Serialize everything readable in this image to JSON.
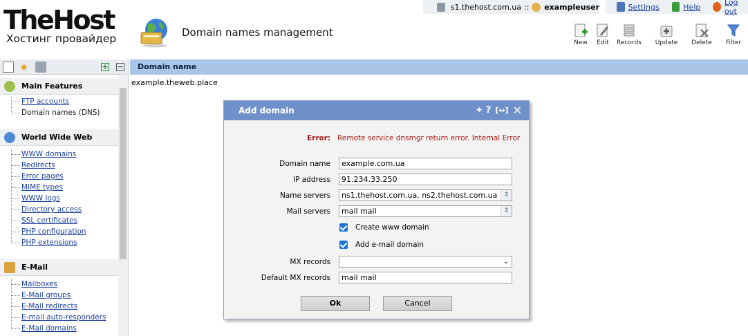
{
  "topbar": {
    "host": "s1.thehost.com.ua",
    "separator": "::",
    "username": "exampleuser",
    "settings": "Settings",
    "help": "Help",
    "logout": "Log out"
  },
  "logo": {
    "main": "TheHost",
    "sub": "Хостинг провайдер"
  },
  "page_title": "Domain names management",
  "toolbar": {
    "new": "New",
    "edit": "Edit",
    "records": "Records",
    "update": "Update",
    "delete": "Delete",
    "filter": "Filter"
  },
  "sidebar": {
    "sections": [
      {
        "title": "Main Features",
        "items": [
          "FTP accounts",
          "Domain names (DNS)"
        ]
      },
      {
        "title": "World Wide Web",
        "items": [
          "WWW domains",
          "Redirects",
          "Error pages",
          "MIME types",
          "WWW logs",
          "Directory access",
          "SSL certificates",
          "PHP configuration",
          "PHP extensions"
        ]
      },
      {
        "title": "E-Mail",
        "items": [
          "Mailboxes",
          "E-Mail groups",
          "E-Mail redirects",
          "E-mail auto-responders",
          "E-Mail domains"
        ]
      }
    ]
  },
  "list": {
    "column": "Domain name",
    "rows": [
      "example.theweb.place"
    ]
  },
  "dialog": {
    "title": "Add domain",
    "error_label": "Error:",
    "error_text": "Remote service dnsmgr return error. Internal Error",
    "fields": {
      "domain_name": {
        "label": "Domain name",
        "value": "example.com.ua"
      },
      "ip_address": {
        "label": "IP address",
        "value": "91.234.33.250"
      },
      "name_servers": {
        "label": "Name servers",
        "value": "ns1.thehost.com.ua. ns2.thehost.com.ua"
      },
      "mail_servers": {
        "label": "Mail servers",
        "value": "mail mail"
      },
      "create_www": {
        "label": "Create www domain",
        "checked": true
      },
      "add_email": {
        "label": "Add e-mail domain",
        "checked": true
      },
      "mx_records": {
        "label": "MX records",
        "value": ""
      },
      "default_mx": {
        "label": "Default MX records",
        "value": "mail mail"
      }
    },
    "ok": "Ok",
    "cancel": "Cancel"
  },
  "colors": {
    "header_blue": "#a9c6e8",
    "dialog_title": "#6f90c9",
    "error_red": "#a31b14",
    "link": "#1a3f9c"
  }
}
